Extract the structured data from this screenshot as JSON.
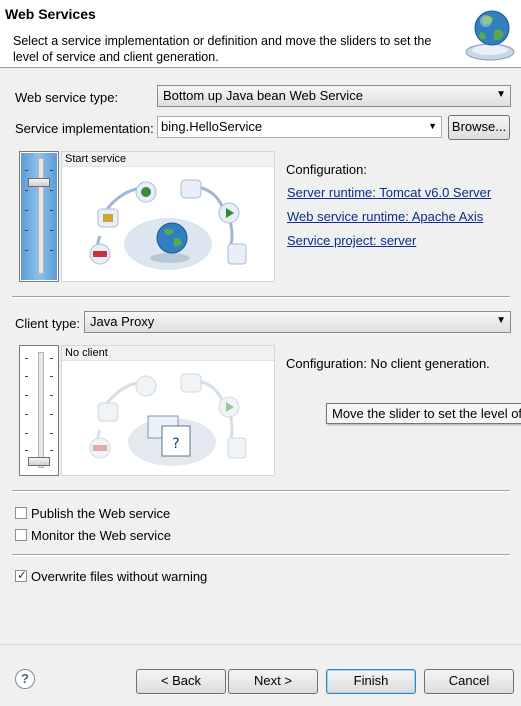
{
  "header": {
    "title": "Web Services",
    "description": "Select a service implementation or definition and move the sliders to set the level of service and client generation.",
    "icon": "web-services-globe-icon"
  },
  "service": {
    "type_label": "Web service type:",
    "type_value": "Bottom up Java bean Web Service",
    "impl_label": "Service implementation:",
    "impl_value": "bing.HelloService",
    "browse_label": "Browse...",
    "slider_caption": "Start service",
    "config_label": "Configuration:",
    "links": [
      "Server runtime: Tomcat v6.0 Server",
      "Web service runtime: Apache Axis",
      "Service project: server"
    ]
  },
  "client": {
    "type_label": "Client type:",
    "type_value": "Java Proxy",
    "slider_caption": "No client",
    "config_text": "Configuration: No client generation.",
    "tooltip": "Move the slider to set the level of client generation"
  },
  "options": {
    "publish_label": "Publish the Web service",
    "publish_checked": false,
    "monitor_label": "Monitor the Web service",
    "monitor_checked": false,
    "overwrite_label": "Overwrite files without warning",
    "overwrite_checked": true
  },
  "footer": {
    "help_icon": "?",
    "back_label": "< Back",
    "next_label": "Next >",
    "finish_label": "Finish",
    "cancel_label": "Cancel"
  },
  "colors": {
    "slider_fill": "#6fa8dc",
    "link": "#0b2e8a"
  }
}
